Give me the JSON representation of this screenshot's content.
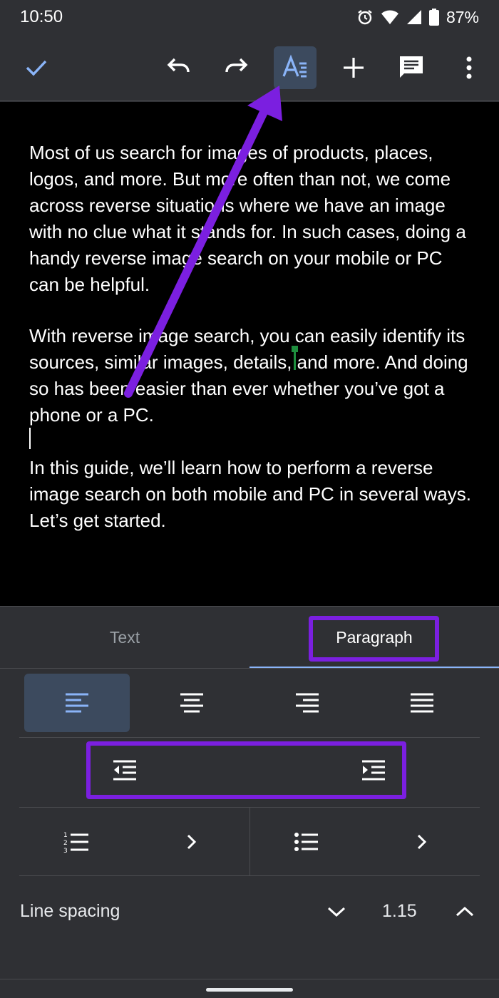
{
  "status_bar": {
    "time": "10:50",
    "battery": "87%"
  },
  "toolbar": {
    "icons": [
      "check-icon",
      "undo-icon",
      "redo-icon",
      "text-format-icon",
      "add-icon",
      "comment-icon",
      "more-vert-icon"
    ]
  },
  "document": {
    "paragraphs": [
      "Most of us search for images of products, places, logos, and more. But more often than not, we come across reverse situations where we have an image with no clue what it stands for. In such cases, doing a handy reverse image search on your mobile or PC can be helpful.",
      "With reverse image search, you can easily identify its sources, similar images, details, and more. And doing so has been easier than ever whether you’ve got a phone or a PC.",
      "In this guide, we’ll learn how to perform a reverse image search on both mobile and PC in several ways. Let’s get started."
    ]
  },
  "format_panel": {
    "tabs": [
      {
        "label": "Text",
        "active": false
      },
      {
        "label": "Paragraph",
        "active": true
      }
    ],
    "alignment": [
      "align-left",
      "align-center",
      "align-right",
      "align-justify"
    ],
    "active_alignment": "align-left",
    "line_spacing": {
      "label": "Line spacing",
      "value": "1.15"
    }
  },
  "colors": {
    "accent_blue": "#8ab4f8",
    "annotation_purple": "#7b1fe0",
    "panel_bg": "#2f3034",
    "doc_bg": "#000000"
  }
}
